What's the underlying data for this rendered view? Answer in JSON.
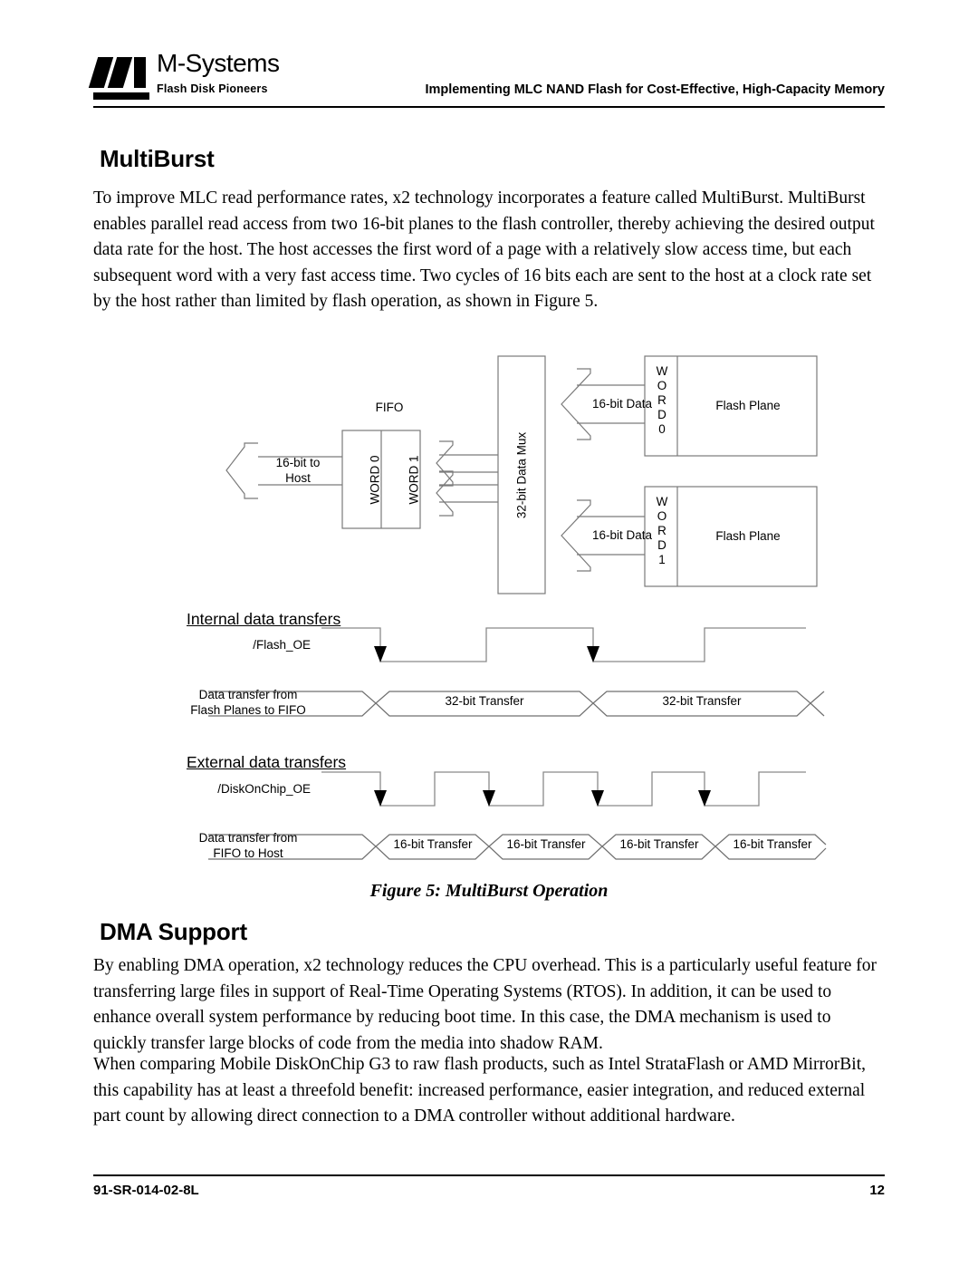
{
  "header": {
    "logo_name": "M-Systems",
    "logo_tagline": "Flash Disk Pioneers",
    "title": "Implementing MLC NAND Flash for Cost-Effective, High-Capacity Memory"
  },
  "sections": {
    "multiburst": {
      "heading": "MultiBurst",
      "paragraph": "To improve MLC read performance rates, x2 technology incorporates a feature called MultiBurst. MultiBurst enables parallel read access from two 16-bit planes to the flash controller, thereby achieving the desired output data rate for the host. The host accesses the first word of a page with a relatively slow access time, but each subsequent word with a very fast access time. Two cycles of 16 bits each are sent to the host at a clock rate set by the host rather than limited by flash operation, as shown in Figure 5."
    },
    "dma": {
      "heading": "DMA Support",
      "paragraph1": "By enabling DMA operation, x2 technology reduces the CPU overhead. This is a particularly useful feature for transferring large files in support of Real-Time Operating Systems (RTOS).  In addition, it can be used to enhance overall system performance by reducing boot time. In this case, the DMA mechanism is used to quickly transfer large blocks of code from the media into shadow RAM.",
      "paragraph2": "When comparing Mobile DiskOnChip G3 to raw flash products, such as Intel StrataFlash or AMD MirrorBit, this capability has at least a threefold benefit: increased performance, easier integration, and reduced external part count by allowing direct connection to a DMA controller without additional hardware."
    }
  },
  "figure": {
    "caption": "Figure 5: MultiBurst Operation",
    "blocks": {
      "fifo_title": "FIFO",
      "fifo_word0": "WORD 0",
      "fifo_word1": "WORD 1",
      "mux": "32-bit Data Mux",
      "flash_plane_0": "Flash Plane",
      "flash_plane_1": "Flash Plane",
      "word0_stack": "W\nO\nR\nD\n0",
      "word1_stack": "W\nO\nR\nD\n1"
    },
    "arrows": {
      "host": "16-bit to\nHost",
      "data_top": "16-bit Data",
      "data_bottom": "16-bit Data"
    },
    "timing": {
      "internal": {
        "title": "Internal data transfers",
        "signal_label": "/Flash_OE",
        "bus_label": "Data transfer from\nFlash Planes to FIFO",
        "bus_values": [
          "32-bit  Transfer",
          "32-bit  Transfer"
        ],
        "pulse_count": 2
      },
      "external": {
        "title": "External data transfers",
        "signal_label": "/DiskOnChip_OE",
        "bus_label": "Data transfer from\nFIFO to Host",
        "bus_values": [
          "16-bit  Transfer",
          "16-bit  Transfer",
          "16-bit  Transfer",
          "16-bit  Transfer"
        ],
        "pulse_count": 4
      }
    }
  },
  "footer": {
    "doc_id": "91-SR-014-02-8L",
    "page_number": "12"
  }
}
